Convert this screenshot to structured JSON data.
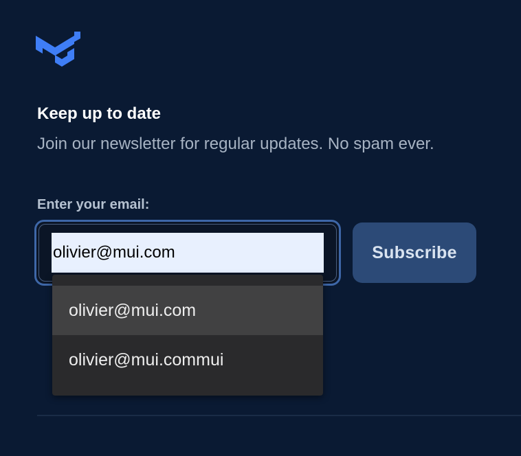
{
  "brand": {
    "logo_icon": "mui-logo-icon",
    "accent_color": "#3f7ef6"
  },
  "newsletter": {
    "heading": "Keep up to date",
    "subtext": "Join our newsletter for regular updates. No spam ever.",
    "email_label": "Enter your email:",
    "email_value": "olivier@mui.com",
    "subscribe_label": "Subscribe"
  },
  "autocomplete": {
    "highlighted_index": 0,
    "items": [
      {
        "label": "olivier@mui.com"
      },
      {
        "label": "olivier@mui.commui"
      }
    ]
  },
  "colors": {
    "background": "#0a1a33",
    "button": "#2c4a77",
    "input_autofill": "#e8f0fe",
    "dropdown": "#2a2a2c",
    "dropdown_highlight": "#414142"
  }
}
